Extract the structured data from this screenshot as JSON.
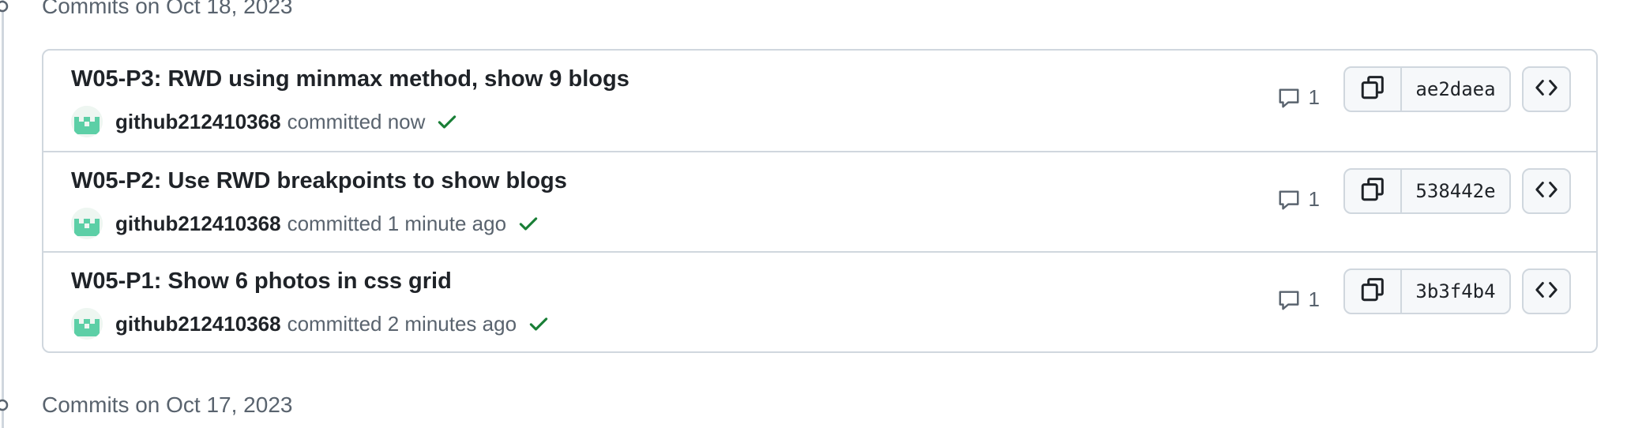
{
  "groups": [
    {
      "header": "Commits on Oct 18, 2023",
      "commits": [
        {
          "title": "W05-P3: RWD using minmax method, show 9 blogs",
          "author": "github212410368",
          "committed_text": "committed now",
          "status": "success",
          "comments": "1",
          "sha": "ae2daea"
        },
        {
          "title": "W05-P2: Use RWD breakpoints to show blogs",
          "author": "github212410368",
          "committed_text": "committed 1 minute ago",
          "status": "success",
          "comments": "1",
          "sha": "538442e"
        },
        {
          "title": "W05-P1: Show 6 photos in css grid",
          "author": "github212410368",
          "committed_text": "committed 2 minutes ago",
          "status": "success",
          "comments": "1",
          "sha": "3b3f4b4"
        }
      ]
    },
    {
      "header": "Commits on Oct 17, 2023",
      "commits": []
    }
  ],
  "icons": {
    "commit_node": "git-commit-icon",
    "comment": "comment-icon",
    "copy": "copy-icon",
    "browse": "code-icon",
    "status": "check-icon",
    "avatar": "identicon-avatar"
  },
  "colors": {
    "success": "#1a7f37",
    "muted": "#59636e",
    "border": "#d0d7de",
    "identicon": "#5ccfa6"
  }
}
